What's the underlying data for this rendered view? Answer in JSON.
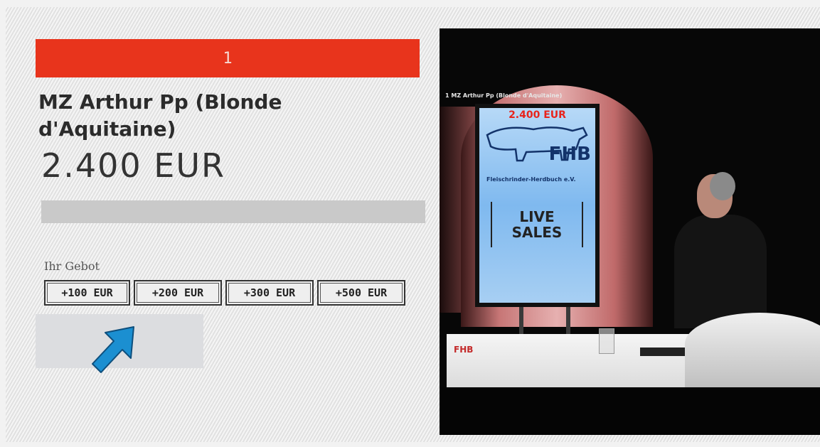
{
  "lot": {
    "number": "1"
  },
  "item": {
    "title": "MZ Arthur Pp (Blonde d'Aquitaine)",
    "price": "2.400 EUR"
  },
  "bid": {
    "label": "Ihr Gebot",
    "buttons": [
      "+100 EUR",
      "+200 EUR",
      "+300 EUR",
      "+500 EUR"
    ]
  },
  "video": {
    "overlay_title": "1  MZ Arthur Pp (Blonde d'Aquitaine)",
    "monitor_price": "2.400 EUR",
    "monitor_logo": "FHB",
    "monitor_org": "Fleischrinder-Herdbuch e.V.",
    "monitor_live": "LIVE",
    "monitor_sales": "SALES",
    "desk_logo": "FHB"
  },
  "colors": {
    "accent": "#e8341c",
    "monitor_blue": "#7fb9ef",
    "arrow": "#1b8fd1"
  },
  "icons": {
    "pointer_arrow": "arrow-up-right-icon"
  }
}
